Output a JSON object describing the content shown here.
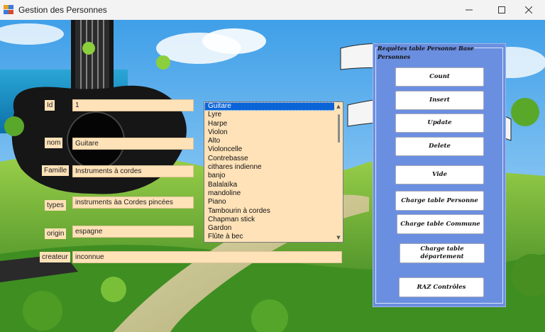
{
  "window": {
    "title": "Gestion des Personnes"
  },
  "form": {
    "id": {
      "label": "Id",
      "value": "1"
    },
    "nom": {
      "label": "nom",
      "value": "Guitare"
    },
    "famille": {
      "label": "Famille",
      "value": "Instruments à cordes"
    },
    "types": {
      "label": "types",
      "value": "instruments àa Cordes pincées"
    },
    "origin": {
      "label": "origin",
      "value": "espagne"
    },
    "createur": {
      "label": "createur",
      "value": "inconnue"
    }
  },
  "list": {
    "selected_index": 0,
    "items": [
      "Guitare",
      "Lyre",
      "Harpe",
      "Violon",
      "Alto",
      "Violoncelle",
      "Contrebasse",
      "cithares indienne",
      "banjo",
      "Balalaïka",
      "mandoline",
      "Piano",
      "Tambourin à cordes",
      "Chapman stick",
      "Gardon",
      "Flûte à bec"
    ]
  },
  "group": {
    "title": "Requêtes table Personne Base Personnes",
    "buttons": {
      "count": "Count",
      "insert": "Insert",
      "update": "Update",
      "delete": "Delete",
      "vide": "Vide",
      "charge_personne": "Charge table Personne",
      "charge_commune": "Charge table Commune",
      "charge_departement": "Charge table département",
      "raz": "RAZ Contrôles"
    }
  }
}
